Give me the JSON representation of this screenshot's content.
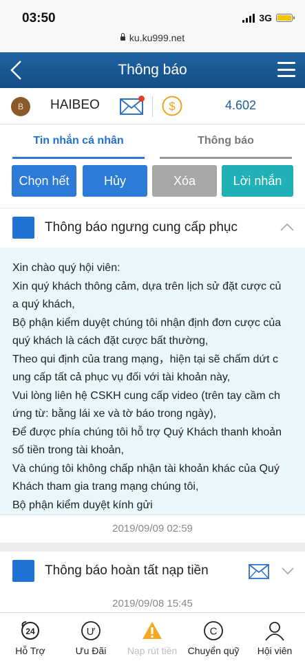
{
  "status_bar": {
    "time": "03:50",
    "network": "3G"
  },
  "browser": {
    "url": "ku.ku999.net"
  },
  "navbar": {
    "title": "Thông báo"
  },
  "user": {
    "avatar_letter": "B",
    "name": "HAIBEO",
    "balance": "4.602"
  },
  "tabs": [
    {
      "label": "Tin nhắn cá nhân",
      "active": true
    },
    {
      "label": "Thông báo",
      "active": false
    }
  ],
  "actions": {
    "select_all": "Chọn hết",
    "cancel": "Hủy",
    "delete": "Xóa",
    "messages": "Lời nhắn"
  },
  "messages": [
    {
      "title": "Thông báo ngưng cung cấp phục",
      "expanded": true,
      "body_lines": [
        "Xin chào quý hội viên:",
        "Xin quý khách thông cảm, dựa trên lịch sử đặt cược củ",
        "a quý khách,",
        "Bộ phận kiểm duyệt chúng tôi nhận định đơn cược của",
        "quý khách là cách đặt cược bất thường,",
        "Theo qui định của trang mạng，hiện tại sẽ chấm dứt c",
        "ung cấp tất cả phục vụ đối với tài khoản này,",
        "Vui lòng liên hệ CSKH cung cấp video (trên tay cầm ch",
        "ứng từ: bằng lái xe và tờ báo trong ngày),",
        "Để được phía chúng tôi hỗ trợ Quý Khách thanh khoản",
        "số tiền trong tài khoản,",
        "Và chúng tôi không chấp nhận tài khoản khác của Quý",
        "Khách tham gia trang mạng chúng tôi,",
        "Bộ phận kiểm duyệt    kính gửi"
      ],
      "date": "2019/09/09 02:59"
    },
    {
      "title": "Thông báo hoàn tất nạp tiền",
      "expanded": false,
      "date": "2019/09/08 15:45"
    }
  ],
  "bottom_nav": [
    {
      "label": "Hỗ Trợ",
      "icon": "support-24-icon",
      "badge": "24"
    },
    {
      "label": "Ưu Đãi",
      "icon": "promo-icon",
      "glyph": "Ư"
    },
    {
      "label": "Nạp rút tiền",
      "icon": "warning-icon"
    },
    {
      "label": "Chuyển quỹ",
      "icon": "transfer-icon",
      "glyph": "C"
    },
    {
      "label": "Hội viên",
      "icon": "member-icon"
    }
  ],
  "colors": {
    "primary": "#1f62a0",
    "tab_active": "#2878d6",
    "button_blue": "#2c7bd6",
    "button_gray": "#a7a7a7",
    "button_teal": "#1fb1b6",
    "body_bg": "#e9f6fc",
    "warning": "#f5a623",
    "badge_red": "#e53b2c"
  }
}
